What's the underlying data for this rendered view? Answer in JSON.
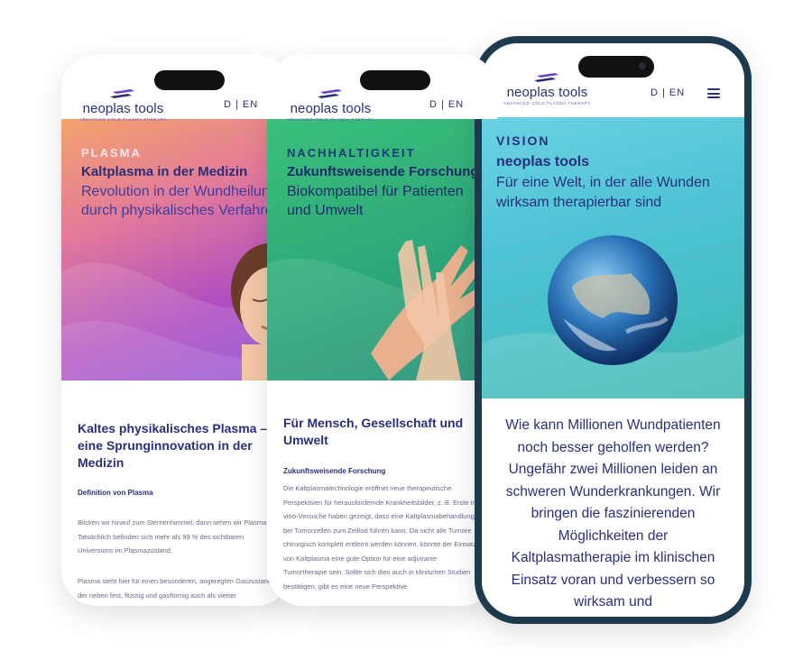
{
  "brand": {
    "name": "neoplas tools",
    "tagline": "ADVANCED COLD PLASMA THERAPY",
    "lang": "D | EN"
  },
  "phone1": {
    "kicker": "PLASMA",
    "title": "Kaltplasma in der Medizin",
    "subtitle": "Revolution in der Wundheilung durch physikalisches Verfahren",
    "heading": "Kaltes physikalisches Plasma – eine Sprunginnovation in der Medizin",
    "subheading": "Definition von Plasma",
    "para1": "Blicken wir hinauf zum Sternenhimmel, dann sehen wir Plasma! Tatsächlich befinden sich mehr als 99 % des sichtbaren Universums im Plasmazustand.",
    "para2": "Plasma steht hier für einen besonderen, angeregten Gaszustand der neben fest, flüssig und gasförmig auch als vierter"
  },
  "phone2": {
    "kicker": "NACHHALTIGKEIT",
    "title": "Zukunftsweisende Forschung",
    "subtitle": "Biokompatibel für Patienten und Umwelt",
    "heading": "Für Mensch, Gesellschaft und Umwelt",
    "subheading": "Zukunftsweisende Forschung",
    "para": "Die Kaltplasmatechnologie eröffnet neue therapeutische Perspektiven für herausfordernde Krankheitsbilder, z. B. Erste In-vitro-Versuche haben gezeigt, dass eine Kaltplasmabehandlung bei Tumorzellen zum Zelltod führen kann. Da nicht alle Tumore chirurgisch komplett entfernt werden können, könnte der Einsatz von Kaltplasma eine gute Option für eine adjuvante Tumortherapie sein. Sollte sich dies auch in klinischen Studien bestätigen, gibt es eine neue Perspektive"
  },
  "phone3": {
    "kicker": "VISION",
    "title": "neoplas tools",
    "subtitle": "Für eine Welt, in der alle Wunden wirksam therapierbar sind",
    "body": "Wie kann Millionen Wundpatienten noch besser geholfen werden? Ungefähr zwei Millionen leiden an schweren Wunderkrankungen. Wir bringen die faszinierenden Möglichkeiten der Kaltplasmatherapie im klinischen Einsatz voran und verbessern so wirksam und"
  },
  "colors": {
    "brand_navy": "#2a2f7a",
    "brand_purple": "#5f5fb8",
    "plasma_kicker": "#ffe7f0",
    "nachhaltigkeit_kicker": "#1f3a7a",
    "vision_kicker": "#2a2f7a"
  }
}
